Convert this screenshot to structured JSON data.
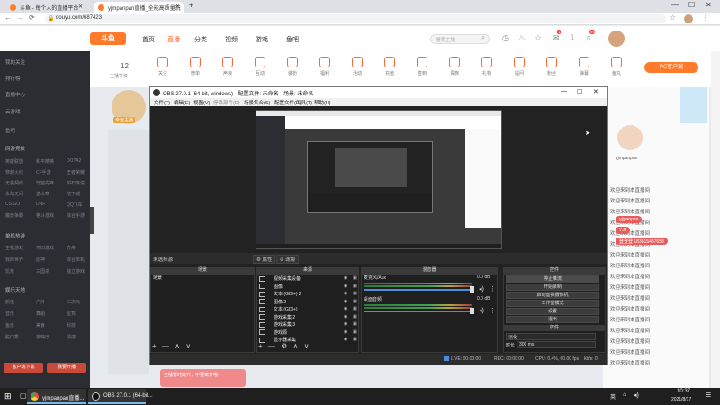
{
  "browser": {
    "tabs": [
      {
        "label": "斗鱼 - 每个人的直播平台",
        "favicon_color": "#ff7a2b",
        "active": false
      },
      {
        "label": "yjmpanpan直播_全能高质量玩",
        "favicon_color": "#ff7a2b",
        "active": true
      }
    ],
    "new_tab": "+",
    "url": "douyu.com/687423",
    "window_controls": [
      "—",
      "☐",
      "✕"
    ]
  },
  "site": {
    "logo": "斗鱼",
    "nav": [
      "首页",
      "直播",
      "分类",
      "视频",
      "游戏",
      "鱼吧"
    ],
    "search_placeholder": "搜索主播",
    "search_btn": "搜索",
    "top_icons": [
      "history",
      "fire",
      "star",
      "mail",
      "download",
      "bell",
      "user"
    ],
    "badges": [
      "1",
      "99"
    ],
    "strip": {
      "level": "12",
      "level_label": "主播等级",
      "items": [
        "关注",
        "榜单",
        "声浪",
        "互动",
        "装扮",
        "福利",
        "活动",
        "充值",
        "签到",
        "贵族",
        "礼物",
        "提问",
        "粉丝",
        "弹幕",
        "鱼丸"
      ],
      "pc_client": "PC客户端"
    },
    "sidebar": {
      "items": [
        "我的关注",
        "排行榜",
        "直播中心",
        "云游戏",
        "鱼吧"
      ],
      "section_games": "网游竞技",
      "games": [
        "英雄联盟",
        "和平精英",
        "DOTA2",
        "穿越火线",
        "CF手游",
        "王者荣耀",
        "无畏契约",
        "守望先锋",
        "炉石传说",
        "永劫无间",
        "逆水寒",
        "地下城",
        "CS:GO",
        "DNF",
        "QQ飞车",
        "魔兽争霸",
        "格斗游戏",
        "综合手游"
      ],
      "section_mobile": "单机热游",
      "mobile": [
        "主机游戏",
        "怀旧游戏",
        "方舟",
        "我的世界",
        "原神",
        "综合单机",
        "饥荒",
        "三国杀",
        "独立游戏"
      ],
      "section_ent": "娱乐天地",
      "ent": [
        "颜值",
        "户外",
        "二次元",
        "音乐",
        "舞蹈",
        "星秀",
        "鱼乐",
        "美食",
        "科技",
        "脱口秀",
        "放映厅",
        "情感"
      ],
      "buttons": [
        "客户端下载",
        "我要开播"
      ]
    },
    "anchor_banner": "幸运主播",
    "streamer_name": "yjmpanpan"
  },
  "obs": {
    "title": "OBS 27.0.1 (64-bit, windows) - 配置文件: 未命名 - 场景: 未命名",
    "menu": [
      "文件(F)",
      "编辑(E)",
      "视图(V)",
      "停靠部件(D)",
      "场景集合(S)",
      "配置文件(P)",
      "工具(T)",
      "帮助(H)"
    ],
    "scene_label": "未选择源",
    "scene_tools": [
      "⚙ 属性",
      "⊘ 滤镜"
    ],
    "docks": {
      "scenes": {
        "title": "场景",
        "items": [
          "场景"
        ]
      },
      "sources": {
        "title": "来源",
        "items": [
          "视频采集设备",
          "图像",
          "文本 (GDI+) 2",
          "图像 2",
          "文本 (GDI+)",
          "游戏采集 2",
          "游戏采集 3",
          "游戏源",
          "显示器采集"
        ]
      },
      "mixer": {
        "title": "混音器",
        "channels": [
          {
            "name": "麦克风/Aux",
            "db": "0.0 dB"
          },
          {
            "name": "桌面音频",
            "db": "0.0 dB"
          }
        ],
        "scale": [
          "-60",
          "-50",
          "-40",
          "-30",
          "-20",
          "-10",
          "-5",
          "0"
        ]
      },
      "controls": {
        "title": "控件",
        "buttons": [
          "停止推流",
          "开始录制",
          "启动虚拟摄像机",
          "工作室模式",
          "设置",
          "退出"
        ]
      },
      "transitions": {
        "title": "转场特效",
        "type": "淡化",
        "duration_label": "时长",
        "duration": "300 ms"
      }
    },
    "foot_buttons": [
      "+",
      "—",
      "∧",
      "∨"
    ],
    "status": {
      "live": "LIVE: 00:00:00",
      "rec": "REC: 00:00:00",
      "cpu": "CPU: 0.4%, 60.00 fps",
      "kb": "kb/s: 0"
    }
  },
  "chat": {
    "overlay_users": [
      {
        "name": "yjjpanpan",
        "color": "#e85c5c"
      },
      {
        "name": "YJJ",
        "color": "#e85c5c"
      },
      {
        "name": "登登登 183815437658",
        "color": "#e85c5c"
      }
    ],
    "messages": [
      "欢迎来到本直播间",
      "欢迎来到本直播间",
      "欢迎来到本直播间",
      "欢迎来到本直播间",
      "欢迎来到本直播间",
      "欢迎来到本直播间",
      "欢迎来到本直播间",
      "欢迎来到本直播间",
      "欢迎来到本直播间",
      "欢迎来到本直播间",
      "欢迎来到本直播间",
      "欢迎来到本直播间",
      "欢迎来到本直播间",
      "欢迎来到本直播间",
      "欢迎来到本直播间",
      "欢迎来到本直播间",
      "欢迎来到本直播间"
    ],
    "popup": "主播暂时离开，不要离开哦~"
  },
  "taskbar": {
    "items": [
      {
        "label": "yjmpanpan直播...",
        "icon": "chrome-icon"
      },
      {
        "label": "OBS 27.0.1 (64-bit...",
        "icon": "obs-icon"
      }
    ],
    "tray": "英",
    "time": "10:37",
    "date": "2021/8/17"
  }
}
